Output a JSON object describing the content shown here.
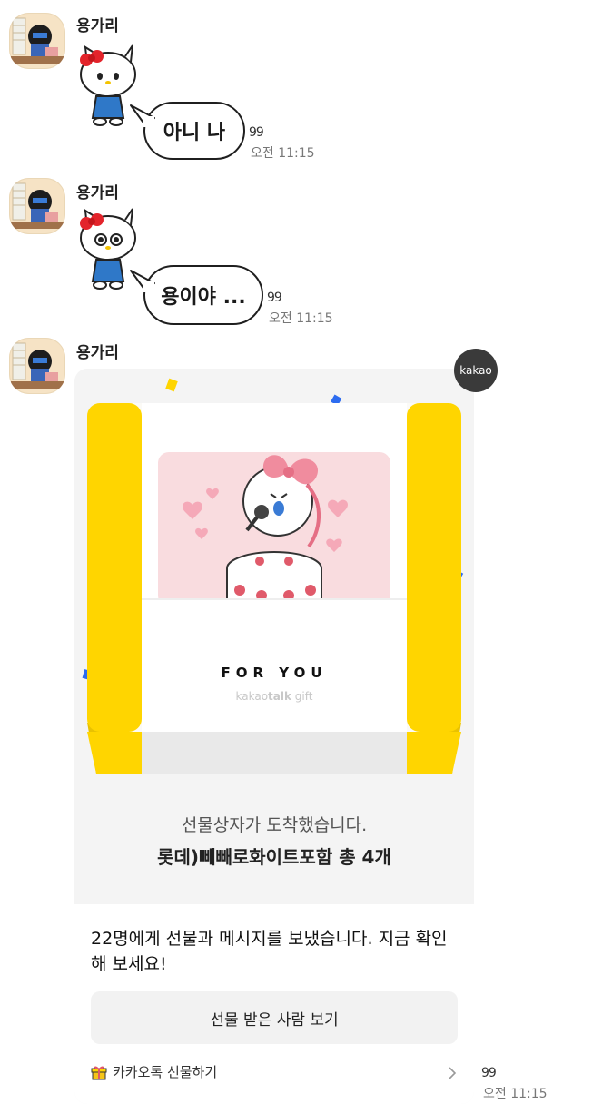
{
  "messages": [
    {
      "sender": "용가리",
      "text": "아니 나",
      "count": "99",
      "time": "오전 11:15"
    },
    {
      "sender": "용가리",
      "text": "용이야 ...",
      "count": "99",
      "time": "오전 11:15"
    },
    {
      "sender": "용가리",
      "count": "99",
      "time": "오전 11:15"
    }
  ],
  "gift": {
    "badge": "kakao",
    "for_you": "FOR YOU",
    "brand_light": "kakao",
    "brand_bold": "talk",
    "brand_tail": " gift",
    "arrived": "선물상자가 도착했습니다.",
    "product": "롯데)빼빼로화이트포함 총 4개",
    "message": "22명에게 선물과 메시지를 보냈습니다. 지금 확인해 보세요!",
    "button": "선물 받은 사람 보기",
    "footer": "카카오톡 선물하기"
  },
  "colors": {
    "ribbon_yellow": "#FFD500",
    "card_pink": "#F9DCDF",
    "confetti_blue": "#2D6CF0",
    "bow_pink": "#F08C9E"
  }
}
